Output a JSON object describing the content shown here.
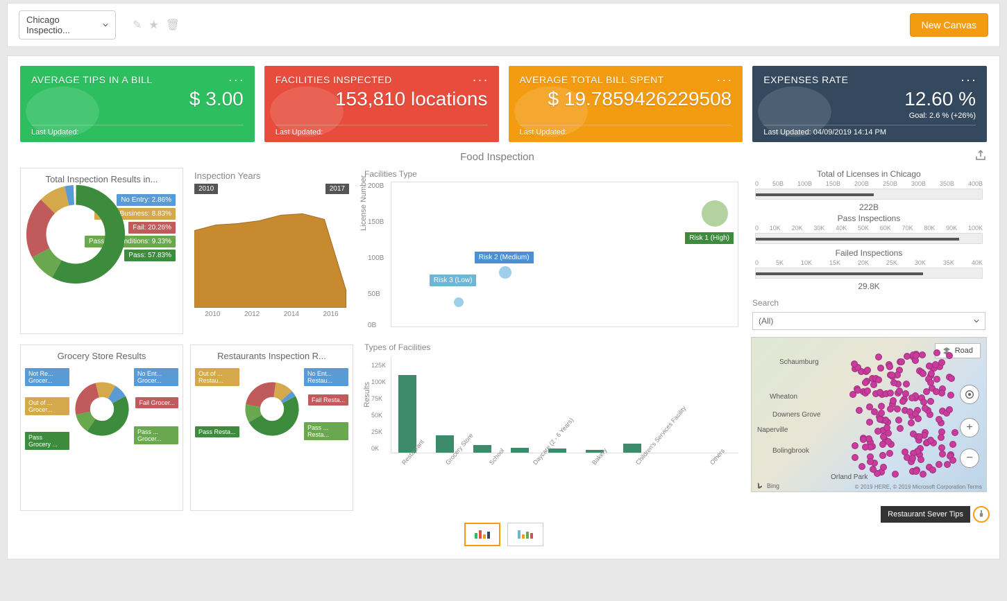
{
  "toolbar": {
    "selector": "Chicago Inspectio...",
    "new_canvas": "New Canvas"
  },
  "cards": [
    {
      "title": "AVERAGE TIPS IN A BILL",
      "value": "$ 3.00",
      "foot": "Last Updated:",
      "color": "c-green"
    },
    {
      "title": "FACILITIES INSPECTED",
      "value": "153,810 locations",
      "foot": "Last Updated:",
      "color": "c-red"
    },
    {
      "title": "AVERAGE TOTAL BILL SPENT",
      "value": "$ 19.7859426229508",
      "foot": "Last Updated:",
      "color": "c-orange"
    },
    {
      "title": "EXPENSES RATE",
      "value": "12.60 %",
      "sub": "Goal: 2.6 % (+26%)",
      "foot": "Last Updated: 04/09/2019 14:14 PM",
      "color": "c-dark"
    }
  ],
  "page_title": "Food Inspection",
  "left": {
    "total_title": "Total Inspection Results in...",
    "total_labels": [
      {
        "text": "No Entry: 2.86%",
        "cls": "blue"
      },
      {
        "text": "Out of Business: 8.83%",
        "cls": "gold"
      },
      {
        "text": "Fail: 20.26%",
        "cls": "red"
      },
      {
        "text": "Pass w/ Conditions: 9.33%",
        "cls": "green"
      },
      {
        "text": "Pass: 57.83%",
        "cls": "dgreen"
      }
    ],
    "insp_title": "Inspection Years",
    "year_start": "2010",
    "year_end": "2017",
    "x_years": [
      "2010",
      "2012",
      "2014",
      "2016"
    ],
    "grocery_title": "Grocery Store Results",
    "grocery_tags": {
      "tl": "Not Re... Grocer...",
      "tr": "No Ent... Grocer...",
      "ml": "Out of ... Grocer...",
      "mr": "Fail Grocer...",
      "bl": "Pass Grocery ...",
      "br": "Pass ... Grocer..."
    },
    "rest_title": "Restaurants Inspection R...",
    "rest_tags": {
      "tl": "Out of ... Restau...",
      "tr": "No Ent... Restau...",
      "ml": "",
      "mr": "Fail Resta...",
      "bl": "Pass Resta...",
      "br": "Pass ... Resta..."
    }
  },
  "mid": {
    "scatter_title": "Facilities Type",
    "y_label": "License Number",
    "y_ticks": [
      "200B",
      "150B",
      "100B",
      "50B",
      "0B"
    ],
    "risk1": "Risk 1 (High)",
    "risk2": "Risk 2 (Medium)",
    "risk3": "Risk 3 (Low)",
    "bars_title": "Types of Facilities",
    "y_label2": "Results",
    "bar_yticks": [
      "125K",
      "100K",
      "75K",
      "50K",
      "25K",
      "0K"
    ],
    "bar_labels": [
      "Restaurant",
      "Grocery Store",
      "School",
      "Daycare (2 - 6 Years)",
      "Bakery",
      "Children's Services Facility",
      "Others"
    ]
  },
  "right": {
    "bullets": [
      {
        "title": "Total of Licenses in Chicago",
        "ticks": [
          "0",
          "50B",
          "100B",
          "150B",
          "200B",
          "250B",
          "300B",
          "350B",
          "400B"
        ],
        "pct": 52,
        "val": "222B"
      },
      {
        "title": "Pass Inspections",
        "ticks": [
          "0",
          "10K",
          "20K",
          "30K",
          "40K",
          "50K",
          "60K",
          "70K",
          "80K",
          "90K",
          "100K"
        ],
        "pct": 90,
        "val": ""
      },
      {
        "title": "Failed Inspections",
        "ticks": [
          "0",
          "5K",
          "10K",
          "15K",
          "20K",
          "25K",
          "30K",
          "35K",
          "40K"
        ],
        "pct": 74,
        "val": "29.8K"
      }
    ],
    "search_lbl": "Search",
    "search_val": "(All)",
    "tooltip": "Restaurant Sever Tips",
    "map": {
      "road": "Road",
      "cities": [
        "Schaumburg",
        "Wheaton",
        "Downers Grove",
        "Naperville",
        "Bolingbrook",
        "Orland Park"
      ],
      "bing": "Bing",
      "credit": "© 2019 HERE, © 2019 Microsoft Corporation Terms"
    }
  },
  "chart_data": [
    {
      "type": "pie",
      "title": "Total Inspection Results",
      "series": [
        {
          "name": "No Entry",
          "value": 2.86
        },
        {
          "name": "Out of Business",
          "value": 8.83
        },
        {
          "name": "Fail",
          "value": 20.26
        },
        {
          "name": "Pass w/ Conditions",
          "value": 9.33
        },
        {
          "name": "Pass",
          "value": 57.83
        }
      ]
    },
    {
      "type": "area",
      "title": "Inspection Years",
      "x": [
        2010,
        2011,
        2012,
        2013,
        2014,
        2015,
        2016,
        2017
      ],
      "values": [
        19000,
        20500,
        21000,
        21500,
        22500,
        23000,
        21500,
        7000
      ],
      "xlabel": "",
      "ylabel": ""
    },
    {
      "type": "pie",
      "title": "Grocery Store Results",
      "series": [
        {
          "name": "Not Ready Grocery",
          "value": 3
        },
        {
          "name": "No Entry Grocery",
          "value": 4
        },
        {
          "name": "Out of Business Grocery",
          "value": 10
        },
        {
          "name": "Fail Grocery",
          "value": 20
        },
        {
          "name": "Pass w/ Conditions Grocery",
          "value": 10
        },
        {
          "name": "Pass Grocery",
          "value": 53
        }
      ]
    },
    {
      "type": "pie",
      "title": "Restaurants Inspection Results",
      "series": [
        {
          "name": "Out of Business Restaurant",
          "value": 9
        },
        {
          "name": "No Entry Restaurant",
          "value": 3
        },
        {
          "name": "Fail Restaurant",
          "value": 20
        },
        {
          "name": "Pass w/ Conditions Restaurant",
          "value": 9
        },
        {
          "name": "Pass Restaurant",
          "value": 59
        }
      ]
    },
    {
      "type": "scatter",
      "title": "Facilities Type",
      "xlabel": "",
      "ylabel": "License Number",
      "ylim": [
        0,
        200
      ],
      "y_unit": "B",
      "series": [
        {
          "name": "Risk 3 (Low)",
          "x": 0.18,
          "y": 30,
          "size": 14
        },
        {
          "name": "Risk 2 (Medium)",
          "x": 0.31,
          "y": 55,
          "size": 18
        },
        {
          "name": "Risk 1 (High)",
          "x": 0.88,
          "y": 160,
          "size": 38
        }
      ]
    },
    {
      "type": "bar",
      "title": "Types of Facilities",
      "ylabel": "Results",
      "ylim": [
        0,
        125000
      ],
      "categories": [
        "Restaurant",
        "Grocery Store",
        "School",
        "Daycare (2 - 6 Years)",
        "Bakery",
        "Children's Services Facility",
        "Others"
      ],
      "values": [
        100000,
        22000,
        10000,
        6000,
        5000,
        4000,
        12000
      ]
    },
    {
      "type": "bar",
      "title": "Total of Licenses in Chicago",
      "categories": [
        ""
      ],
      "values": [
        222
      ],
      "x_unit": "B",
      "xlim": [
        0,
        400
      ]
    },
    {
      "type": "bar",
      "title": "Pass Inspections",
      "categories": [
        ""
      ],
      "values": [
        90000
      ],
      "xlim": [
        0,
        100000
      ]
    },
    {
      "type": "bar",
      "title": "Failed Inspections",
      "categories": [
        ""
      ],
      "values": [
        29800
      ],
      "xlim": [
        0,
        40000
      ]
    }
  ]
}
